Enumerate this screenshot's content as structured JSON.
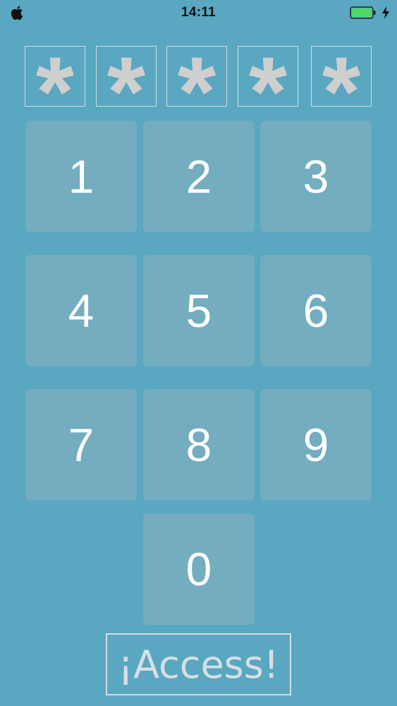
{
  "status_bar": {
    "time": "14:11",
    "battery_level_percent": 100,
    "charging": true,
    "icons": [
      "apple-logo-icon",
      "battery-icon",
      "charging-bolt-icon"
    ]
  },
  "pin": {
    "slots": [
      "*",
      "*",
      "*",
      "*",
      "*"
    ]
  },
  "keypad": {
    "keys": [
      "1",
      "2",
      "3",
      "4",
      "5",
      "6",
      "7",
      "8",
      "9",
      "0"
    ]
  },
  "access_button": {
    "label": "¡Access!"
  },
  "colors": {
    "background": "#59a7c1",
    "key_fill": "#73adbf",
    "key_text": "#ffffff",
    "pin_symbol": "#cfcfcf",
    "outline": "#d4dee2",
    "battery_fill": "#4cd964"
  }
}
